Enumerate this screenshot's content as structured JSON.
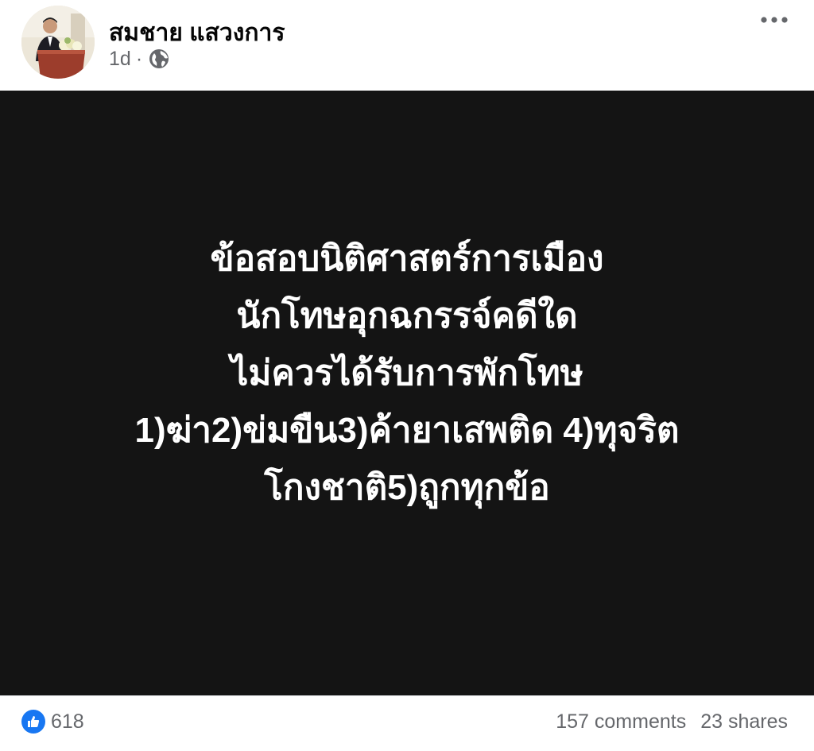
{
  "post": {
    "author": {
      "name": "สมชาย แสวงการ"
    },
    "time": "1d",
    "separator": "·",
    "privacy_icon": "globe-icon",
    "menu_icon": "more-dots-icon",
    "image": {
      "background": "#141414",
      "text_color": "#ffffff",
      "lines": [
        "ข้อสอบนิติศาสตร์การเมือง",
        "นักโทษอุกฉกรรจ์คดีใด",
        "ไม่ควรได้รับการพักโทษ",
        "1)ฆ่า2)ข่มขืน3)ค้ายาเสพติด 4)ทุจริต",
        "โกงชาติ5)ถูกทุกข้อ"
      ]
    },
    "footer": {
      "reaction_icon": "like-icon",
      "reaction_count": "618",
      "comments": "157 comments",
      "shares": "23 shares"
    },
    "colors": {
      "accent": "#1877f2",
      "secondary_text": "#65676b",
      "primary_text": "#050505"
    }
  }
}
